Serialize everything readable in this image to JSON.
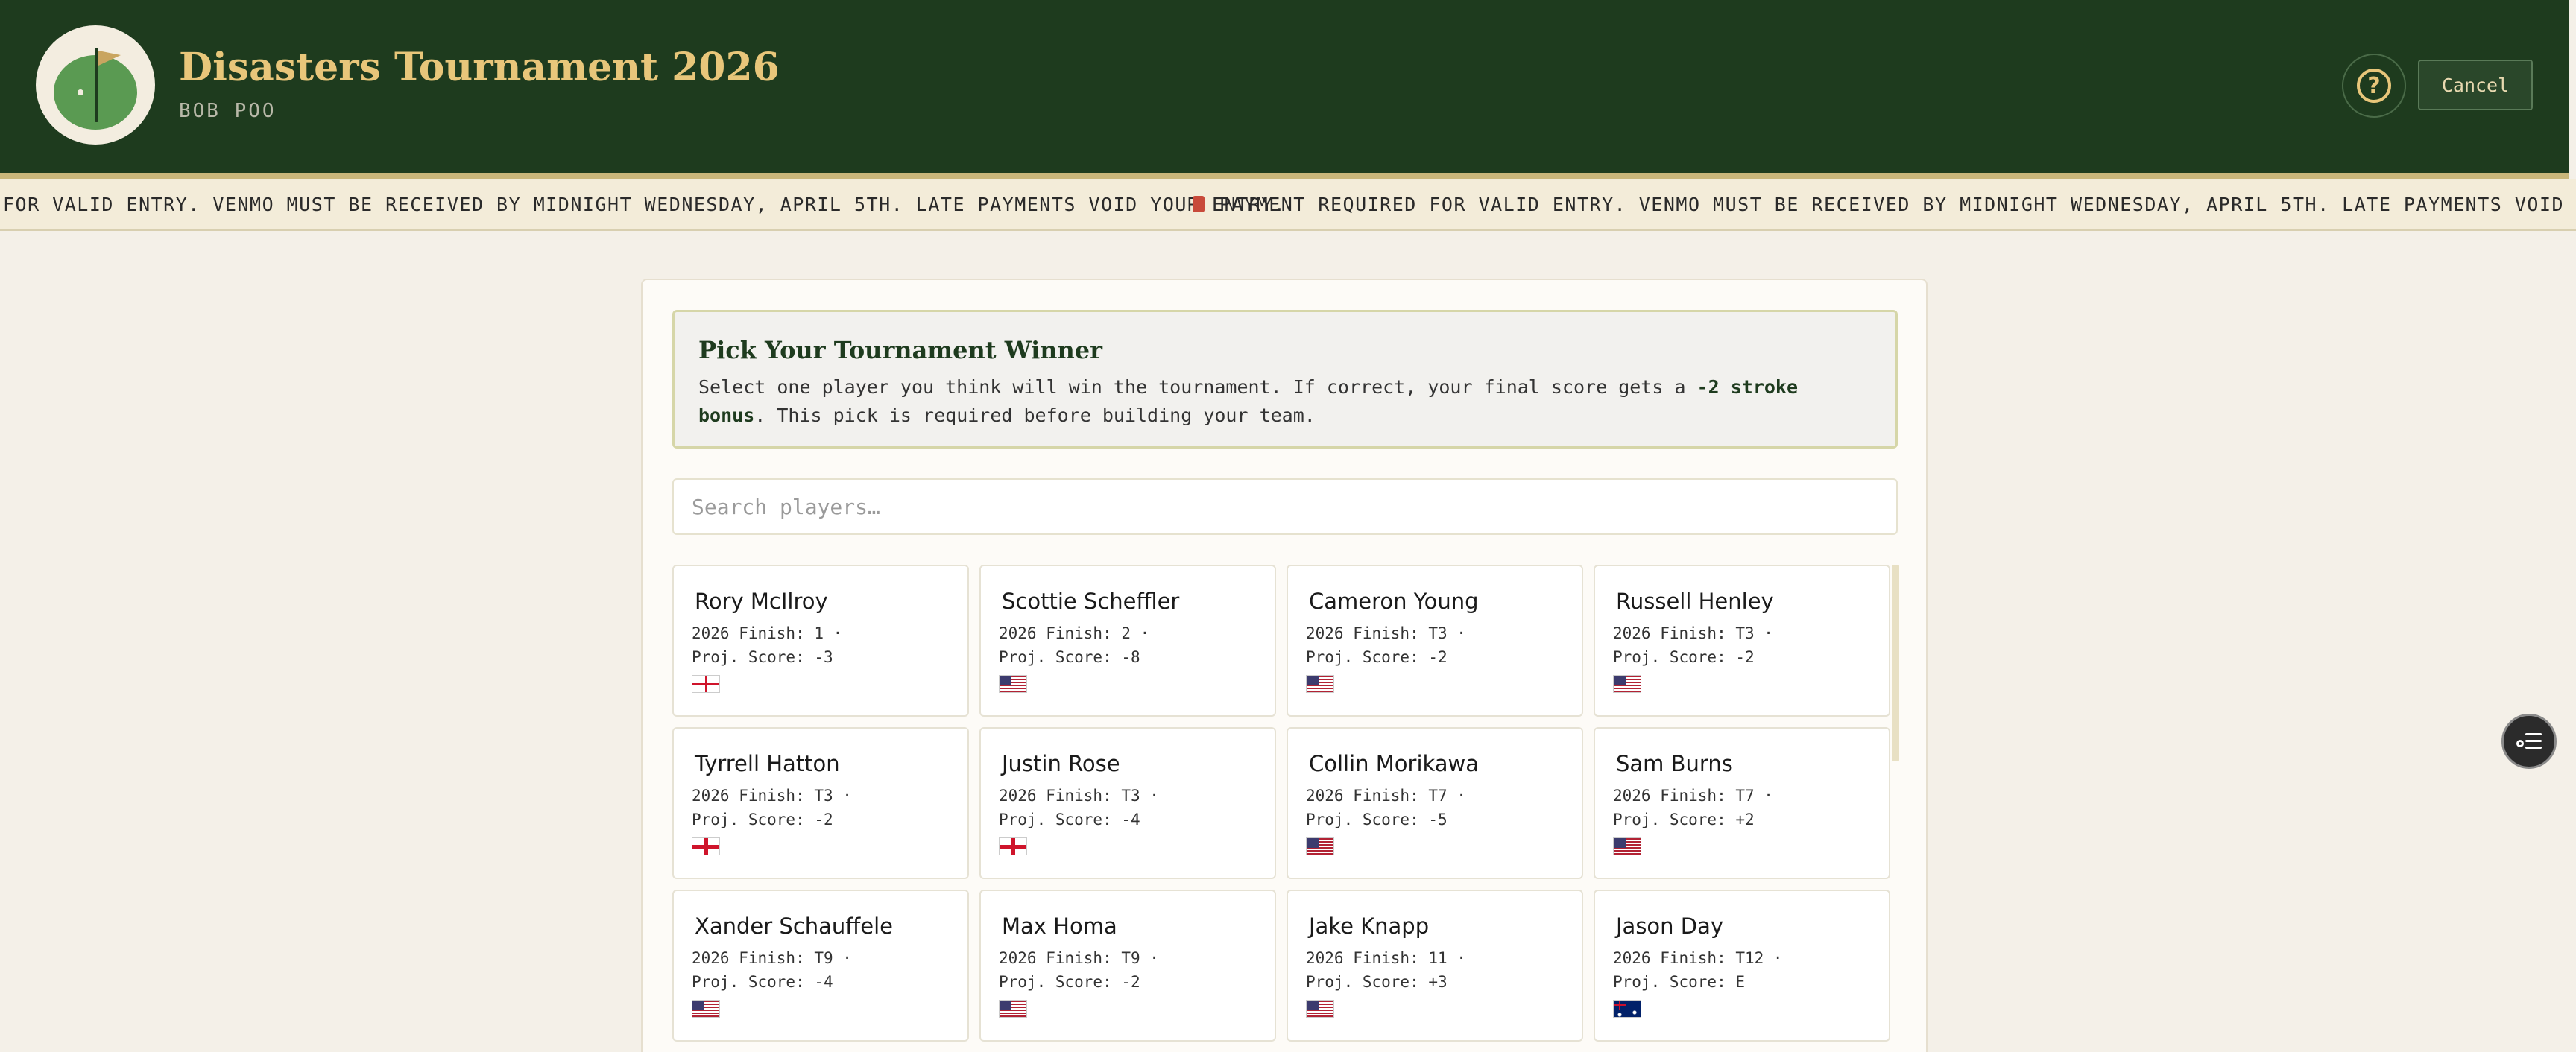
{
  "header": {
    "title": "Disasters Tournament 2026",
    "subtitle": "BOB POO",
    "cancel_label": "Cancel",
    "help_label": "?",
    "colors": {
      "bg": "#1e3b1e",
      "accent": "#e8c67a"
    }
  },
  "ticker": {
    "text_a": "FOR VALID ENTRY. VENMO MUST BE RECEIVED BY MIDNIGHT WEDNESDAY, APRIL 5TH. LATE PAYMENTS VOID YOUR ENTRY.",
    "text_b": "PAYMENT REQUIRED FOR VALID ENTRY. VENMO MUST BE RECEIVED BY MIDNIGHT WEDNESDAY, APRIL 5TH. LATE PAYMENTS VOID YOUR ENTRY.",
    "icon": "pin-icon"
  },
  "picker": {
    "title": "Pick Your Tournament Winner",
    "text_before": "Select one player you think will win the tournament. If correct, your final score gets a ",
    "bonus": "-2 stroke bonus",
    "text_after": ". This pick is required before building your team.",
    "search_placeholder": "Search players…"
  },
  "players": [
    {
      "name": "Rory McIlroy",
      "finish": "2026 Finish: 1 ·",
      "proj": "Proj. Score: -3",
      "flag": "nir"
    },
    {
      "name": "Scottie Scheffler",
      "finish": "2026 Finish: 2 ·",
      "proj": "Proj. Score: -8",
      "flag": "us"
    },
    {
      "name": "Cameron Young",
      "finish": "2026 Finish: T3 ·",
      "proj": "Proj. Score: -2",
      "flag": "us"
    },
    {
      "name": "Russell Henley",
      "finish": "2026 Finish: T3 ·",
      "proj": "Proj. Score: -2",
      "flag": "us"
    },
    {
      "name": "Tyrrell Hatton",
      "finish": "2026 Finish: T3 ·",
      "proj": "Proj. Score: -2",
      "flag": "eng"
    },
    {
      "name": "Justin Rose",
      "finish": "2026 Finish: T3 ·",
      "proj": "Proj. Score: -4",
      "flag": "eng"
    },
    {
      "name": "Collin Morikawa",
      "finish": "2026 Finish: T7 ·",
      "proj": "Proj. Score: -5",
      "flag": "us"
    },
    {
      "name": "Sam Burns",
      "finish": "2026 Finish: T7 ·",
      "proj": "Proj. Score: +2",
      "flag": "us"
    },
    {
      "name": "Xander Schauffele",
      "finish": "2026 Finish: T9 ·",
      "proj": "Proj. Score: -4",
      "flag": "us"
    },
    {
      "name": "Max Homa",
      "finish": "2026 Finish: T9 ·",
      "proj": "Proj. Score: -2",
      "flag": "us"
    },
    {
      "name": "Jake Knapp",
      "finish": "2026 Finish: 11 ·",
      "proj": "Proj. Score: +3",
      "flag": "us"
    },
    {
      "name": "Jason Day",
      "finish": "2026 Finish: T12 ·",
      "proj": "Proj. Score: E",
      "flag": "aus"
    }
  ]
}
